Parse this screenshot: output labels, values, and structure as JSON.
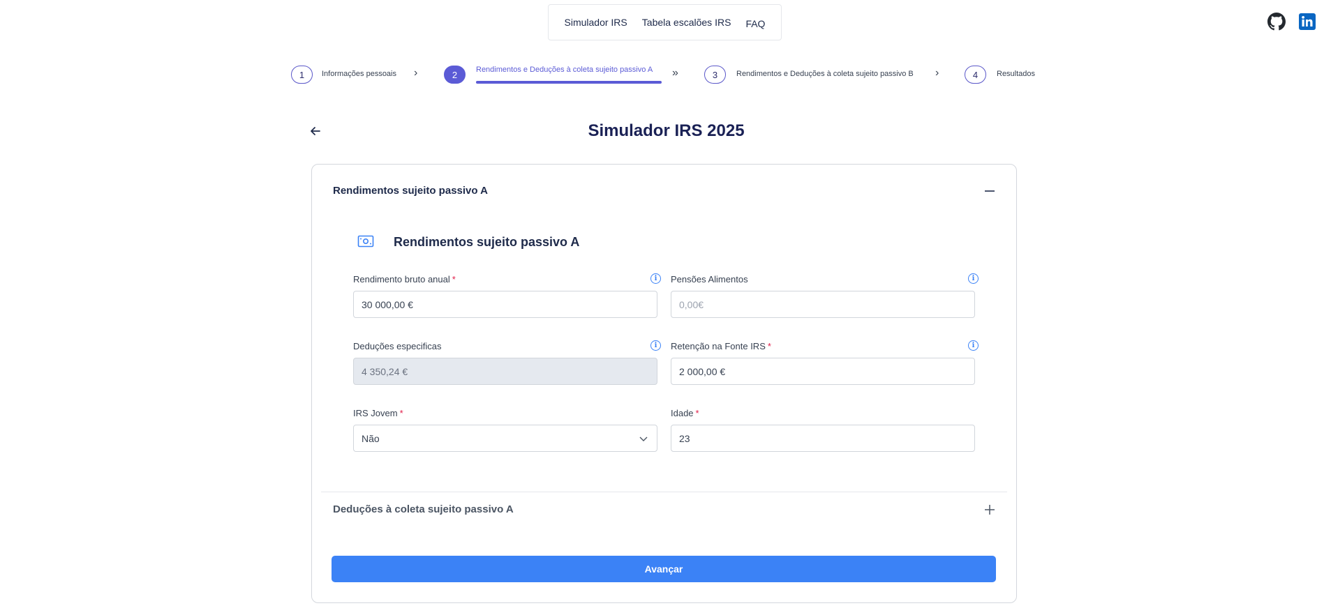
{
  "nav": {
    "items": [
      "Simulador IRS",
      "Tabela escalões IRS",
      "FAQ"
    ]
  },
  "social": {
    "github": "github-icon",
    "linkedin": "linkedin-icon"
  },
  "stepper": {
    "steps": [
      {
        "number": "1",
        "label": "Informações pessoais"
      },
      {
        "number": "2",
        "label": "Rendimentos e Deduções à coleta sujeito passivo A"
      },
      {
        "number": "3",
        "label": "Rendimentos e Deduções à coleta sujeito passivo B"
      },
      {
        "number": "4",
        "label": "Resultados"
      }
    ],
    "active_step": 2
  },
  "header": {
    "title": "Simulador IRS 2025"
  },
  "accordion1": {
    "title": "Rendimentos sujeito passivo A",
    "section_title": "Rendimentos sujeito passivo A",
    "fields": {
      "rendimento": {
        "label": "Rendimento bruto anual",
        "required": "*",
        "value": "30 000,00 €"
      },
      "pensoes": {
        "label": "Pensões Alimentos",
        "placeholder": "0,00€"
      },
      "deducoes": {
        "label": "Deduções especificas",
        "value": "4 350,24 €"
      },
      "retencao": {
        "label": "Retenção na Fonte IRS",
        "required": "*",
        "value": "2 000,00 €"
      },
      "irs_jovem": {
        "label": "IRS Jovem",
        "required": "*",
        "value": "Não"
      },
      "idade": {
        "label": "Idade",
        "required": "*",
        "value": "23"
      }
    }
  },
  "accordion2": {
    "title": "Deduções à coleta sujeito passivo A"
  },
  "actions": {
    "next_label": "Avançar"
  },
  "colors": {
    "accent": "#5b5bd6",
    "primary_button": "#3b82f6",
    "required": "#e11d48"
  }
}
